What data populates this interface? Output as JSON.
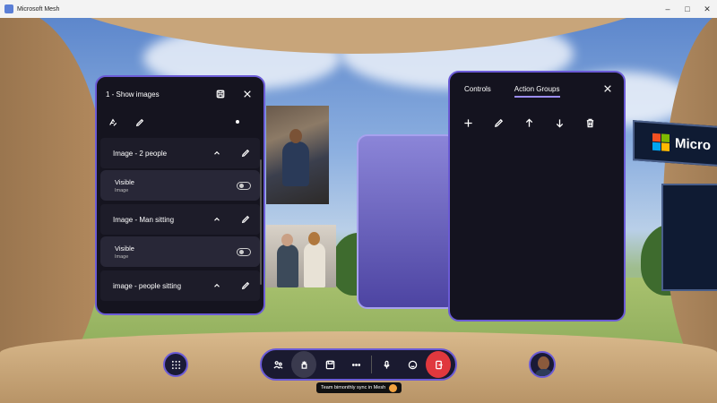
{
  "window": {
    "title": "Microsoft Mesh",
    "minimize": "–",
    "maximize": "□",
    "close": "✕"
  },
  "left_panel": {
    "title": "1 - Show images",
    "groups": [
      {
        "title": "Image - 2 people",
        "visible_label": "Visible",
        "type_label": "Image"
      },
      {
        "title": "Image - Man sitting",
        "visible_label": "Visible",
        "type_label": "Image"
      },
      {
        "title": "image - people sitting"
      }
    ]
  },
  "right_panel": {
    "tabs": [
      "Controls",
      "Action Groups"
    ],
    "active_tab": "Action Groups"
  },
  "billboard": {
    "brand": "Micro"
  },
  "bottom_bar": {
    "event_label": "Team bimonthly sync in Mesh",
    "leave_color": "#e0383e"
  },
  "colors": {
    "accent": "#6b5bd6",
    "panel_bg": "#15141f",
    "ms_red": "#f25022",
    "ms_green": "#7fba00",
    "ms_blue": "#00a4ef",
    "ms_yellow": "#ffb900"
  }
}
